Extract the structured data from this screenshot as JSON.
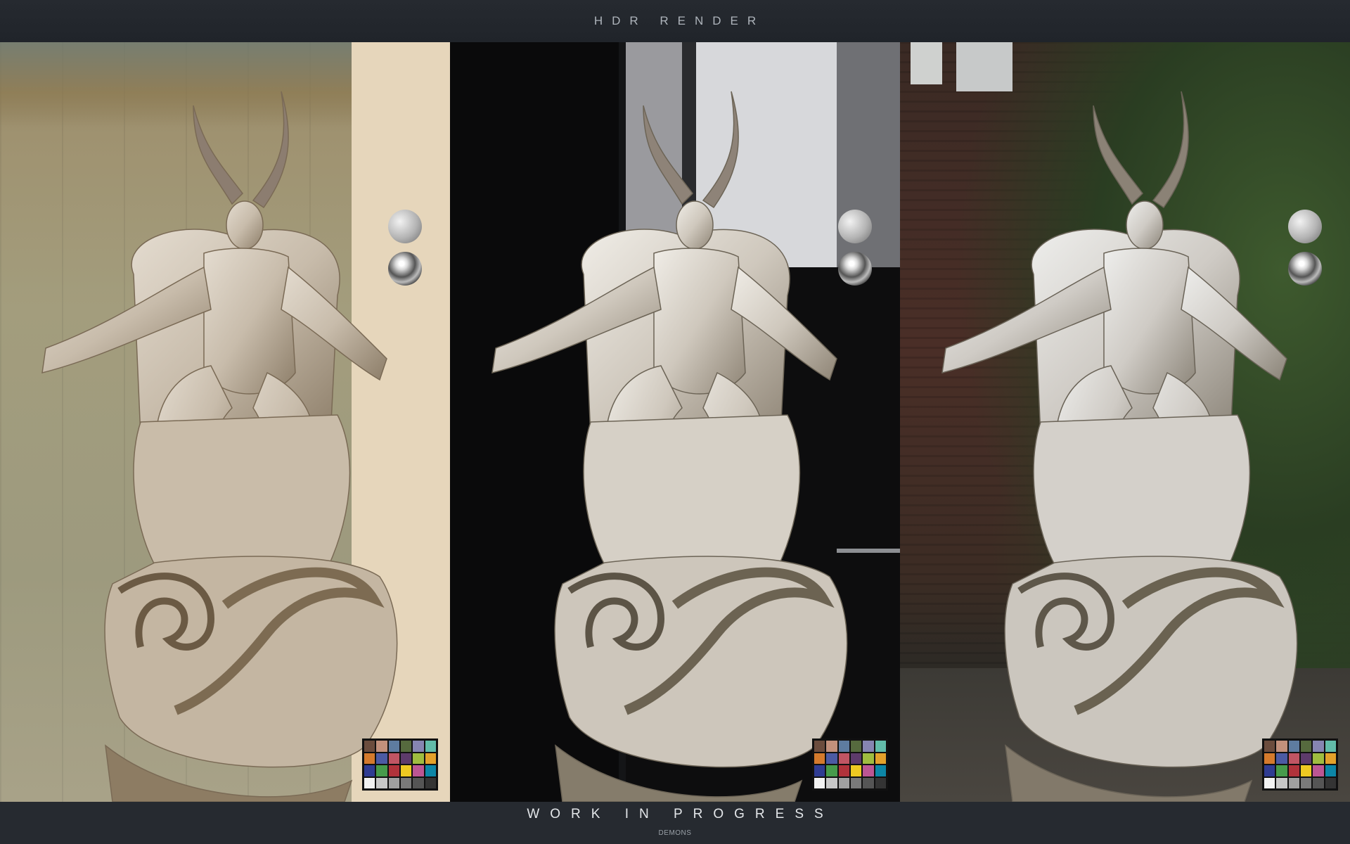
{
  "header": {
    "title": "HDR RENDER"
  },
  "footer": {
    "subtitle": "WORK IN PROGRESS",
    "caption": "DEMONS"
  },
  "panels": [
    {
      "id": "panel-1",
      "environment": "weathered-wall"
    },
    {
      "id": "panel-2",
      "environment": "dark-studio"
    },
    {
      "id": "panel-3",
      "environment": "brick-courtyard"
    }
  ],
  "reference_objects": [
    "grey-sphere",
    "chrome-sphere",
    "color-checker"
  ],
  "checker_colors": [
    "#6b4c3d",
    "#c2917c",
    "#5e7ca0",
    "#566a3e",
    "#8685b1",
    "#62bca9",
    "#d47a2c",
    "#4c5aa3",
    "#c05563",
    "#5d3b6b",
    "#9fbc3f",
    "#e3a12a",
    "#2f3c92",
    "#479a4b",
    "#b1333b",
    "#eec922",
    "#bc5693",
    "#0d86a6",
    "#f2f2f2",
    "#c8c8c8",
    "#a0a0a0",
    "#7a7a7a",
    "#555555",
    "#343434"
  ]
}
